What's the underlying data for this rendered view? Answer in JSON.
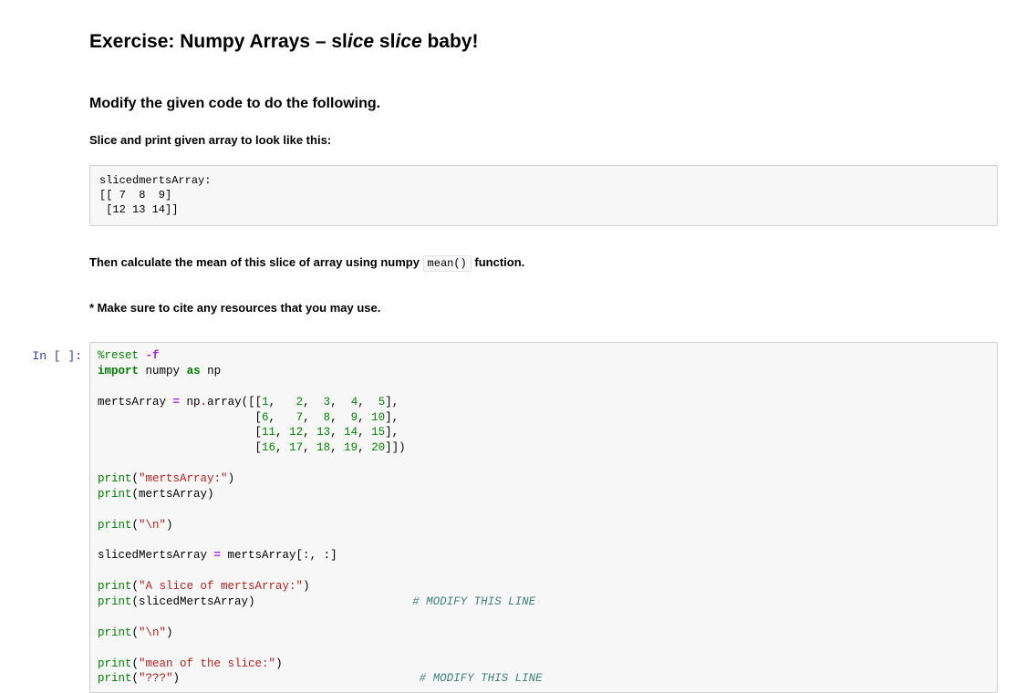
{
  "markdown": {
    "title_prefix": "Exercise: Numpy Arrays – sl",
    "title_italic1": "ice",
    "title_mid": " sl",
    "title_italic2": "ice",
    "title_suffix": " baby!",
    "subtitle": "Modify the given code to do the following.",
    "slice_instruction": "Slice and print given array to look like this:",
    "expected_output": "slicedmertsArray:\n[[ 7  8  9]\n [12 13 14]]",
    "mean_before": "Then calculate the mean of this slice of array using numpy ",
    "mean_code": "mean()",
    "mean_after": " function.",
    "cite_note": "* Make sure to cite any resources that you may use."
  },
  "code_prompt": "In [ ]:",
  "code_tokens": {
    "l0_magic": "%reset",
    "l0_flag": "-f",
    "l1_import": "import",
    "l1_numpy": "numpy",
    "l1_as": "as",
    "l1_np": "np",
    "l3_var": "mertsArray ",
    "l3_eq": "=",
    "l3_np": " np",
    "l3_dot": ".",
    "l3_array": "array",
    "l3_open": "([[",
    "l3_n1": "1",
    "l3_c": ",   ",
    "l3_n2": "2",
    "l3_c2": ",  ",
    "l3_n3": "3",
    "l3_c3": ",  ",
    "l3_n4": "4",
    "l3_c4": ",  ",
    "l3_n5": "5",
    "l3_close": "],",
    "l4_pad": "                       [",
    "l4_n1": "6",
    "l4_c": ",   ",
    "l4_n2": "7",
    "l4_c2": ",  ",
    "l4_n3": "8",
    "l4_c3": ",  ",
    "l4_n4": "9",
    "l4_c4": ", ",
    "l4_n5": "10",
    "l4_close": "],",
    "l5_pad": "                       [",
    "l5_n1": "11",
    "l5_c": ", ",
    "l5_n2": "12",
    "l5_c2": ", ",
    "l5_n3": "13",
    "l5_c3": ", ",
    "l5_n4": "14",
    "l5_c4": ", ",
    "l5_n5": "15",
    "l5_close": "],",
    "l6_pad": "                       [",
    "l6_n1": "16",
    "l6_c": ", ",
    "l6_n2": "17",
    "l6_c2": ", ",
    "l6_n3": "18",
    "l6_c3": ", ",
    "l6_n4": "19",
    "l6_c4": ", ",
    "l6_n5": "20",
    "l6_close": "]])",
    "l8_print": "print",
    "l8_open": "(",
    "l8_str": "\"mertsArray:\"",
    "l8_close": ")",
    "l9_print": "print",
    "l9_open": "(",
    "l9_arg": "mertsArray",
    "l9_close": ")",
    "l11_print": "print",
    "l11_open": "(",
    "l11_str": "\"\\n\"",
    "l11_close": ")",
    "l13_var": "slicedMertsArray ",
    "l13_eq": "=",
    "l13_rhs": " mertsArray[:, :]",
    "l15_print": "print",
    "l15_open": "(",
    "l15_str": "\"A slice of mertsArray:\"",
    "l15_close": ")",
    "l16_print": "print",
    "l16_open": "(",
    "l16_arg": "slicedMertsArray",
    "l16_close": ")",
    "l16_pad": "                       ",
    "l16_comment": "# MODIFY THIS LINE",
    "l18_print": "print",
    "l18_open": "(",
    "l18_str": "\"\\n\"",
    "l18_close": ")",
    "l20_print": "print",
    "l20_open": "(",
    "l20_str": "\"mean of the slice:\"",
    "l20_close": ")",
    "l21_print": "print",
    "l21_open": "(",
    "l21_str": "\"???\"",
    "l21_close": ")",
    "l21_pad": "                                   ",
    "l21_comment": "# MODIFY THIS LINE"
  }
}
